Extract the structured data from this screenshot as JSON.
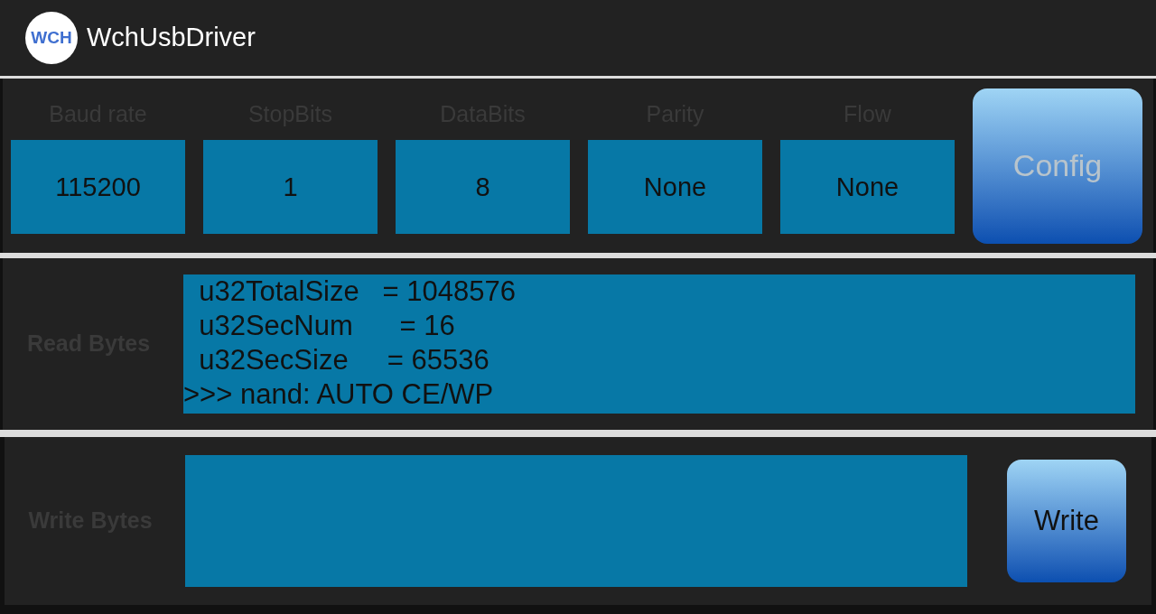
{
  "app_bar": {
    "title": "WchUsbDriver",
    "logo_text": "WCH"
  },
  "config": {
    "fields": [
      {
        "label": "Baud rate",
        "value": "115200"
      },
      {
        "label": "StopBits",
        "value": "1"
      },
      {
        "label": "DataBits",
        "value": "8"
      },
      {
        "label": "Parity",
        "value": "None"
      },
      {
        "label": "Flow",
        "value": "None"
      }
    ],
    "button": {
      "label": "Config",
      "disabled": true
    }
  },
  "read": {
    "label": "Read Bytes",
    "lines": [
      "  u32TotalSize   = 1048576",
      "  u32SecNum      = 16",
      "  u32SecSize     = 65536",
      ">>> nand: AUTO CE/WP"
    ]
  },
  "write": {
    "label": "Write Bytes",
    "button": {
      "label": "Write",
      "disabled": false
    }
  }
}
